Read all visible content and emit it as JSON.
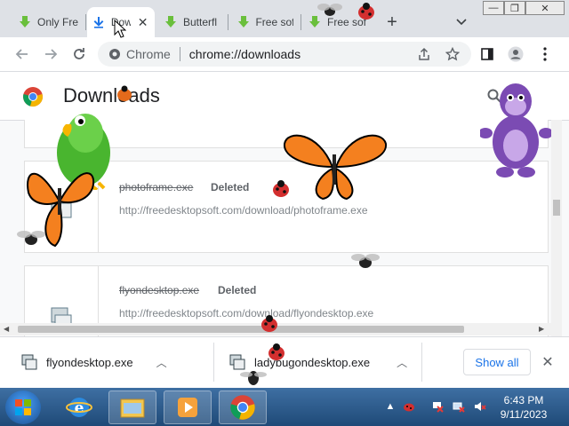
{
  "tabs": [
    {
      "title": "Only Fre",
      "icon": "download-arrow-icon"
    },
    {
      "title": "Dow",
      "icon": "download-icon",
      "active": true
    },
    {
      "title": "Butterfl",
      "icon": "download-arrow-icon"
    },
    {
      "title": "Free sof",
      "icon": "download-arrow-icon"
    },
    {
      "title": "Free sof",
      "icon": "download-arrow-icon"
    }
  ],
  "omnibox": {
    "chip": "Chrome",
    "url": "chrome://downloads"
  },
  "page": {
    "title": "Downloads",
    "items": [
      {
        "filename": "photoframe.exe",
        "status": "Deleted",
        "url": "http://freedesktopsoft.com/download/photoframe.exe"
      },
      {
        "filename": "flyondesktop.exe",
        "status": "Deleted",
        "url": "http://freedesktopsoft.com/download/flyondesktop.exe"
      }
    ]
  },
  "shelf": {
    "items": [
      {
        "name": "flyondesktop.exe"
      },
      {
        "name": "ladybugondesktop.exe"
      }
    ],
    "show_all": "Show all"
  },
  "clock": {
    "time": "6:43 PM",
    "date": "9/11/2023"
  },
  "colors": {
    "accent": "#1a73e8",
    "tab_download_green": "#6abf3c",
    "taskbar": "#2a5a8c"
  }
}
